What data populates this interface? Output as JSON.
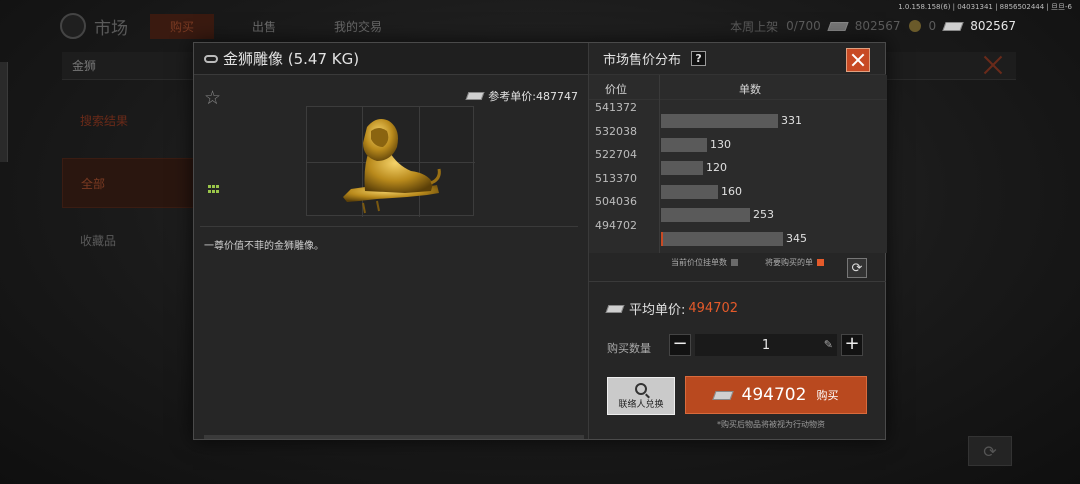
{
  "version": "1.0.158.158(6) | 04031341 | 8856502444 | 旦旦-6",
  "top": {
    "title": "市场",
    "tabs": [
      "购买",
      "出售",
      "我的交易"
    ],
    "listing_label": "本周上架",
    "listing_value": "0/700",
    "money_a": "802567",
    "coin_value": "0",
    "money_b": "802567"
  },
  "background": {
    "subbar_title": "金狮",
    "side_search": "搜索结果",
    "side_all": "全部",
    "side_collection": "收藏品"
  },
  "item": {
    "name": "金狮雕像 (5.47 KG)",
    "ref_price_label": "参考单价:",
    "ref_price": "487747",
    "description": "一尊价值不菲的金狮雕像。"
  },
  "distribution": {
    "title": "市场售价分布",
    "help": "?",
    "col_price": "价位",
    "col_qty": "单数",
    "legend_current": "当前价位挂单数",
    "legend_buy": "将要购买的单",
    "refresh_icon": "⟳"
  },
  "chart_data": {
    "type": "bar",
    "orientation": "horizontal",
    "title": "市场售价分布",
    "xlabel": "单数",
    "ylabel": "价位",
    "categories": [
      "541372",
      "532038",
      "522704",
      "513370",
      "504036",
      "494702"
    ],
    "values": [
      331,
      130,
      120,
      160,
      253,
      345
    ],
    "highlight_category": "494702",
    "colors": {
      "bar": "#5a5a5a",
      "highlight": "#c84a24"
    }
  },
  "purchase": {
    "avg_label": "平均单价:",
    "avg_value": "494702",
    "qty_label": "购买数量",
    "minus": "−",
    "qty": "1",
    "plus": "+",
    "contact_label": "联络人兑换",
    "buy_price": "494702",
    "buy_label": "购买",
    "note": "*购买后物品将被视为行动物资"
  },
  "colors": {
    "accent": "#c84a24",
    "price_highlight": "#e45a2a",
    "legend_grid": "#9ac64a"
  }
}
